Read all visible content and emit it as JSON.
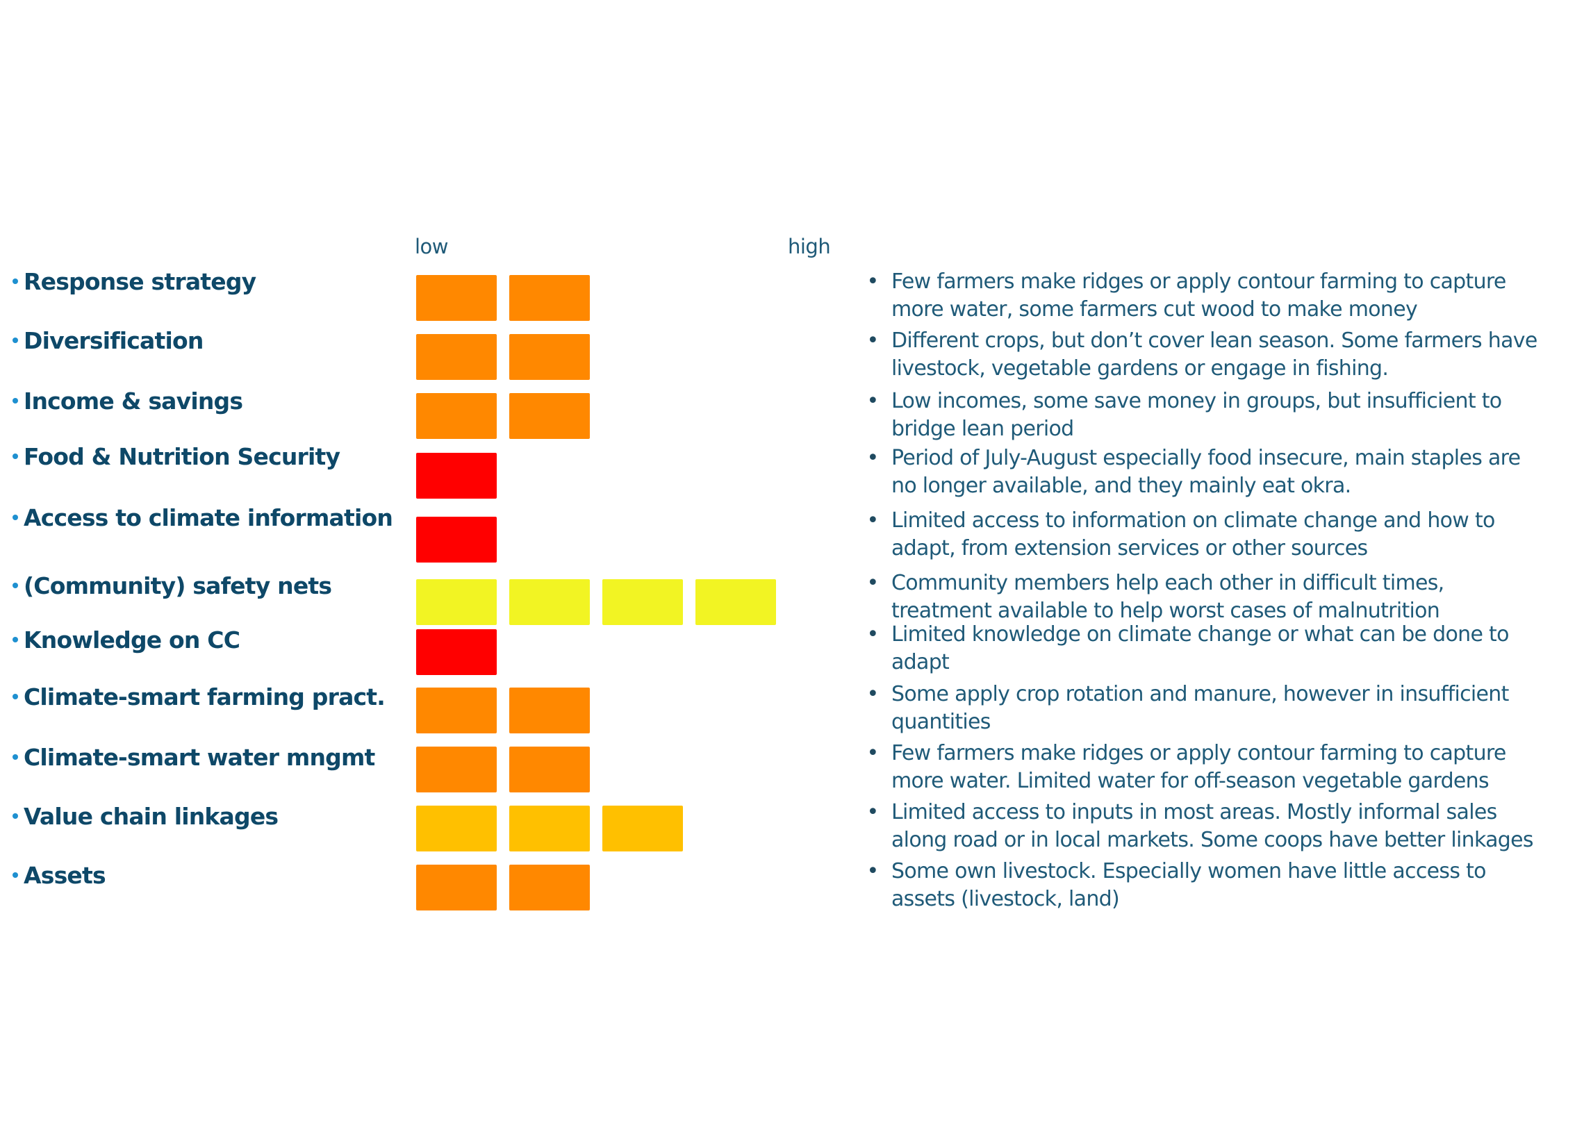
{
  "chart_data": {
    "type": "table",
    "title": "",
    "scale": {
      "min_label": "low",
      "max_label": "high",
      "min": 1,
      "max": 4
    },
    "colors": {
      "red": "#ff0000",
      "orange": "#ff8800",
      "gold": "#ffc000",
      "yellow": "#f2f423"
    },
    "rows": [
      {
        "label": "Response strategy",
        "value": 2,
        "color": "orange",
        "description": [
          "Few farmers make ridges or apply contour farming to capture",
          "more water, some farmers cut wood to make money"
        ]
      },
      {
        "label": "Diversification",
        "value": 2,
        "color": "orange",
        "description": [
          "Different crops, but don’t cover lean season. Some farmers have",
          "livestock, vegetable gardens or engage in fishing."
        ]
      },
      {
        "label": "Income & savings",
        "value": 2,
        "color": "orange",
        "description": [
          "Low incomes, some save money in groups, but insufficient to",
          "bridge lean period"
        ]
      },
      {
        "label": "Food & Nutrition Security",
        "value": 1,
        "color": "red",
        "description": [
          "Period of July-August especially food insecure, main staples are",
          "no longer available, and they mainly eat okra."
        ]
      },
      {
        "label": "Access to climate information",
        "value": 1,
        "color": "red",
        "description": [
          "Limited access to information on climate change and how to",
          "adapt, from extension services or other sources"
        ]
      },
      {
        "label": "(Community) safety nets",
        "value": 4,
        "color": "yellow",
        "description": [
          "Community members help each other in difficult times,",
          "treatment available to help worst cases of malnutrition"
        ]
      },
      {
        "label": "Knowledge on CC",
        "value": 1,
        "color": "red",
        "description": [
          "Limited knowledge on climate change or what can be done to",
          "adapt"
        ]
      },
      {
        "label": "Climate-smart farming pract.",
        "value": 2,
        "color": "orange",
        "description": [
          "Some apply crop rotation and manure, however in insufficient",
          "quantities"
        ]
      },
      {
        "label": "Climate-smart water mngmt",
        "value": 2,
        "color": "orange",
        "description": [
          "Few farmers make ridges or apply contour farming to capture",
          "more water. Limited water for off-season vegetable gardens"
        ]
      },
      {
        "label": "Value chain linkages",
        "value": 3,
        "color": "gold",
        "description": [
          "Limited access to inputs in most areas. Mostly informal sales",
          "along road or in local markets. Some coops have better linkages"
        ]
      },
      {
        "label": "Assets",
        "value": 2,
        "color": "orange",
        "description": [
          "Some own livestock. Especially women have little access to",
          "assets (livestock, land)"
        ]
      }
    ]
  }
}
